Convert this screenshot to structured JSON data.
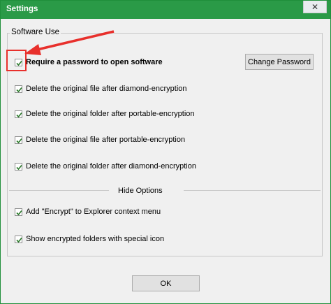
{
  "window": {
    "title": "Settings",
    "close_glyph": "✕"
  },
  "group": {
    "title": "Software Use"
  },
  "password_option": {
    "label": "Require a password to open software",
    "checked": true
  },
  "change_password_button": "Change Password",
  "options": [
    {
      "label": "Delete the original file after diamond-encryption",
      "checked": true
    },
    {
      "label": "Delete the original folder after portable-encryption",
      "checked": true
    },
    {
      "label": "Delete the original file after portable-encryption",
      "checked": true
    },
    {
      "label": "Delete the original folder after diamond-encryption",
      "checked": true
    }
  ],
  "hide_options": {
    "title": "Hide Options",
    "items": [
      {
        "label": "Add \"Encrypt\" to Explorer context menu",
        "checked": true
      },
      {
        "label": "Show encrypted folders with special icon",
        "checked": true
      }
    ]
  },
  "ok_button": "OK",
  "colors": {
    "titlebar": "#2a9a47",
    "annotation": "#e8302c",
    "check": "#2b7a2b"
  },
  "icons": {
    "checkmark": "checkmark-icon",
    "close": "close-icon",
    "arrow": "red-arrow-annotation"
  }
}
